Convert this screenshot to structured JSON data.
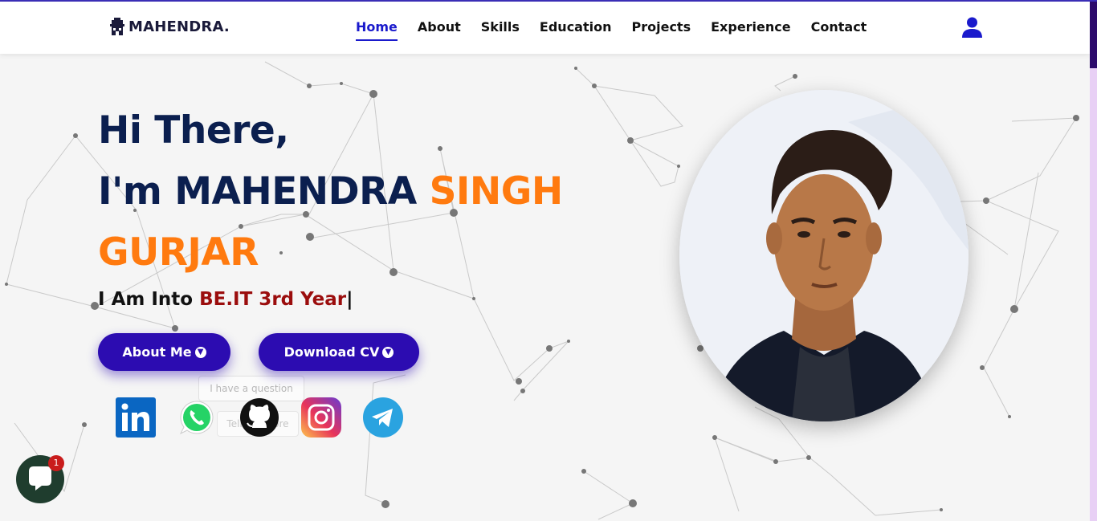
{
  "brand": {
    "name": "MAHENDRA."
  },
  "nav": {
    "items": [
      {
        "label": "Home",
        "active": true
      },
      {
        "label": "About"
      },
      {
        "label": "Skills"
      },
      {
        "label": "Education"
      },
      {
        "label": "Projects"
      },
      {
        "label": "Experience"
      },
      {
        "label": "Contact"
      }
    ]
  },
  "hero": {
    "greeting": "Hi There,",
    "intro": "I'm MAHENDRA ",
    "highlight_1": "SINGH",
    "highlight_2": "GURJAR",
    "typed_prefix": "I Am Into ",
    "typed_value": "BE.IT 3rd Year",
    "typed_cursor": "|",
    "about_button": "About Me",
    "cv_button": "Download CV"
  },
  "ghost_widget": {
    "question": "I have a question",
    "second": "Tell me more"
  },
  "social": [
    "linkedin-icon",
    "whatsapp-icon",
    "github-icon",
    "instagram-icon",
    "telegram-icon"
  ],
  "chat": {
    "badge": "1"
  },
  "colors": {
    "navy": "#0b1f4f",
    "orange": "#ff7a0f",
    "button": "#2c0cb1",
    "typed_red": "#9b0d0d",
    "nav_active": "#1a1acc"
  }
}
